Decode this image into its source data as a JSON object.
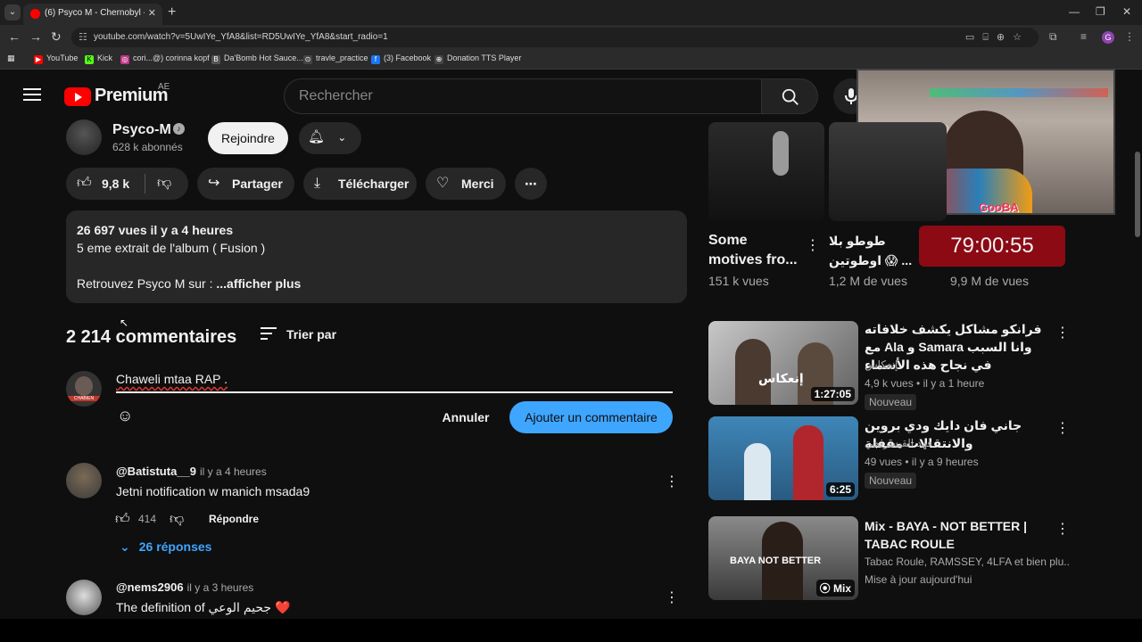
{
  "browser": {
    "tab_title": "(6) Psyco M - Chernobyl - YouTube",
    "tab_close": "✕",
    "url": "youtube.com/watch?v=5UwIYe_YfA8&list=RD5UwIYe_YfA8&start_radio=1",
    "bookmarks": [
      "YouTube",
      "Kick",
      "cori...@) corinna kopf",
      "Da'Bomb Hot Sauce...",
      "travle_practice",
      "(3) Facebook",
      "Donation TTS Player"
    ],
    "profile_initial": "G"
  },
  "header": {
    "logo_text": "Premium",
    "country_code": "AE",
    "search_placeholder": "Rechercher"
  },
  "webcam": {
    "tag": "GooBA"
  },
  "channel": {
    "name": "Psyco-M",
    "subscribers": "628 k abonnés",
    "join_label": "Rejoindre"
  },
  "actions": {
    "likes": "9,8 k",
    "share": "Partager",
    "download": "Télécharger",
    "thanks": "Merci"
  },
  "description": {
    "meta": "26 697 vues  il y a 4 heures",
    "line1": "5 eme extrait de l'album ( Fusion )",
    "line2": "Retrouvez Psyco M sur :",
    "more": " ...afficher plus"
  },
  "comments": {
    "count_label": "2 214 commentaires",
    "sort_label": "Trier par",
    "draft": "Chaweli mtaa RAP .",
    "my_avatar_label": "CHABIEN",
    "cancel": "Annuler",
    "submit": "Ajouter un commentaire",
    "items": [
      {
        "author": "@Batistuta__9",
        "time": "il y a 4 heures",
        "text": "Jetni notification w manich msada9",
        "likes": "414",
        "reply": "Répondre",
        "replies": "26 réponses"
      },
      {
        "author": "@nems2906",
        "time": "il y a 3 heures",
        "text": "The definition of جحيم الوعي ❤️"
      }
    ]
  },
  "shorts": [
    {
      "title_line1": "Some",
      "title_line2": "motives fro...",
      "views": "151 k vues"
    },
    {
      "title_line1": "طوطو بلا",
      "title_line2": "اوطوتين 😱 ...",
      "views": "1,2 M de vues"
    },
    {
      "timer": "79:00:55",
      "views": "9,9 M de vues"
    }
  ],
  "recommendations": [
    {
      "title": "فرانكو مشاكل يكشف خلافاته مع Ala و Samara وانا السبب في نجاح هذه الأسماء",
      "channel": "إنعكاس",
      "meta": "4,9 k vues • il y a 1 heure",
      "badge": "Nouveau",
      "duration": "1:27:05",
      "thumb_text": "إنعكاس"
    },
    {
      "title": "جاني فان دايك ودي بروين والانتقالات مقفلة",
      "channel": "فهد القيسرنجي",
      "meta": "49 vues • il y a 9 heures",
      "badge": "Nouveau",
      "duration": "6:25"
    },
    {
      "title": "Mix - BAYA - NOT BETTER | TABAC ROULE",
      "channel": "Tabac Roule, RAMSSEY, 4LFA et bien plu...",
      "meta": "Mise à jour aujourd'hui",
      "duration": "Mix",
      "thumb_text": "BAYA NOT BETTER"
    }
  ]
}
